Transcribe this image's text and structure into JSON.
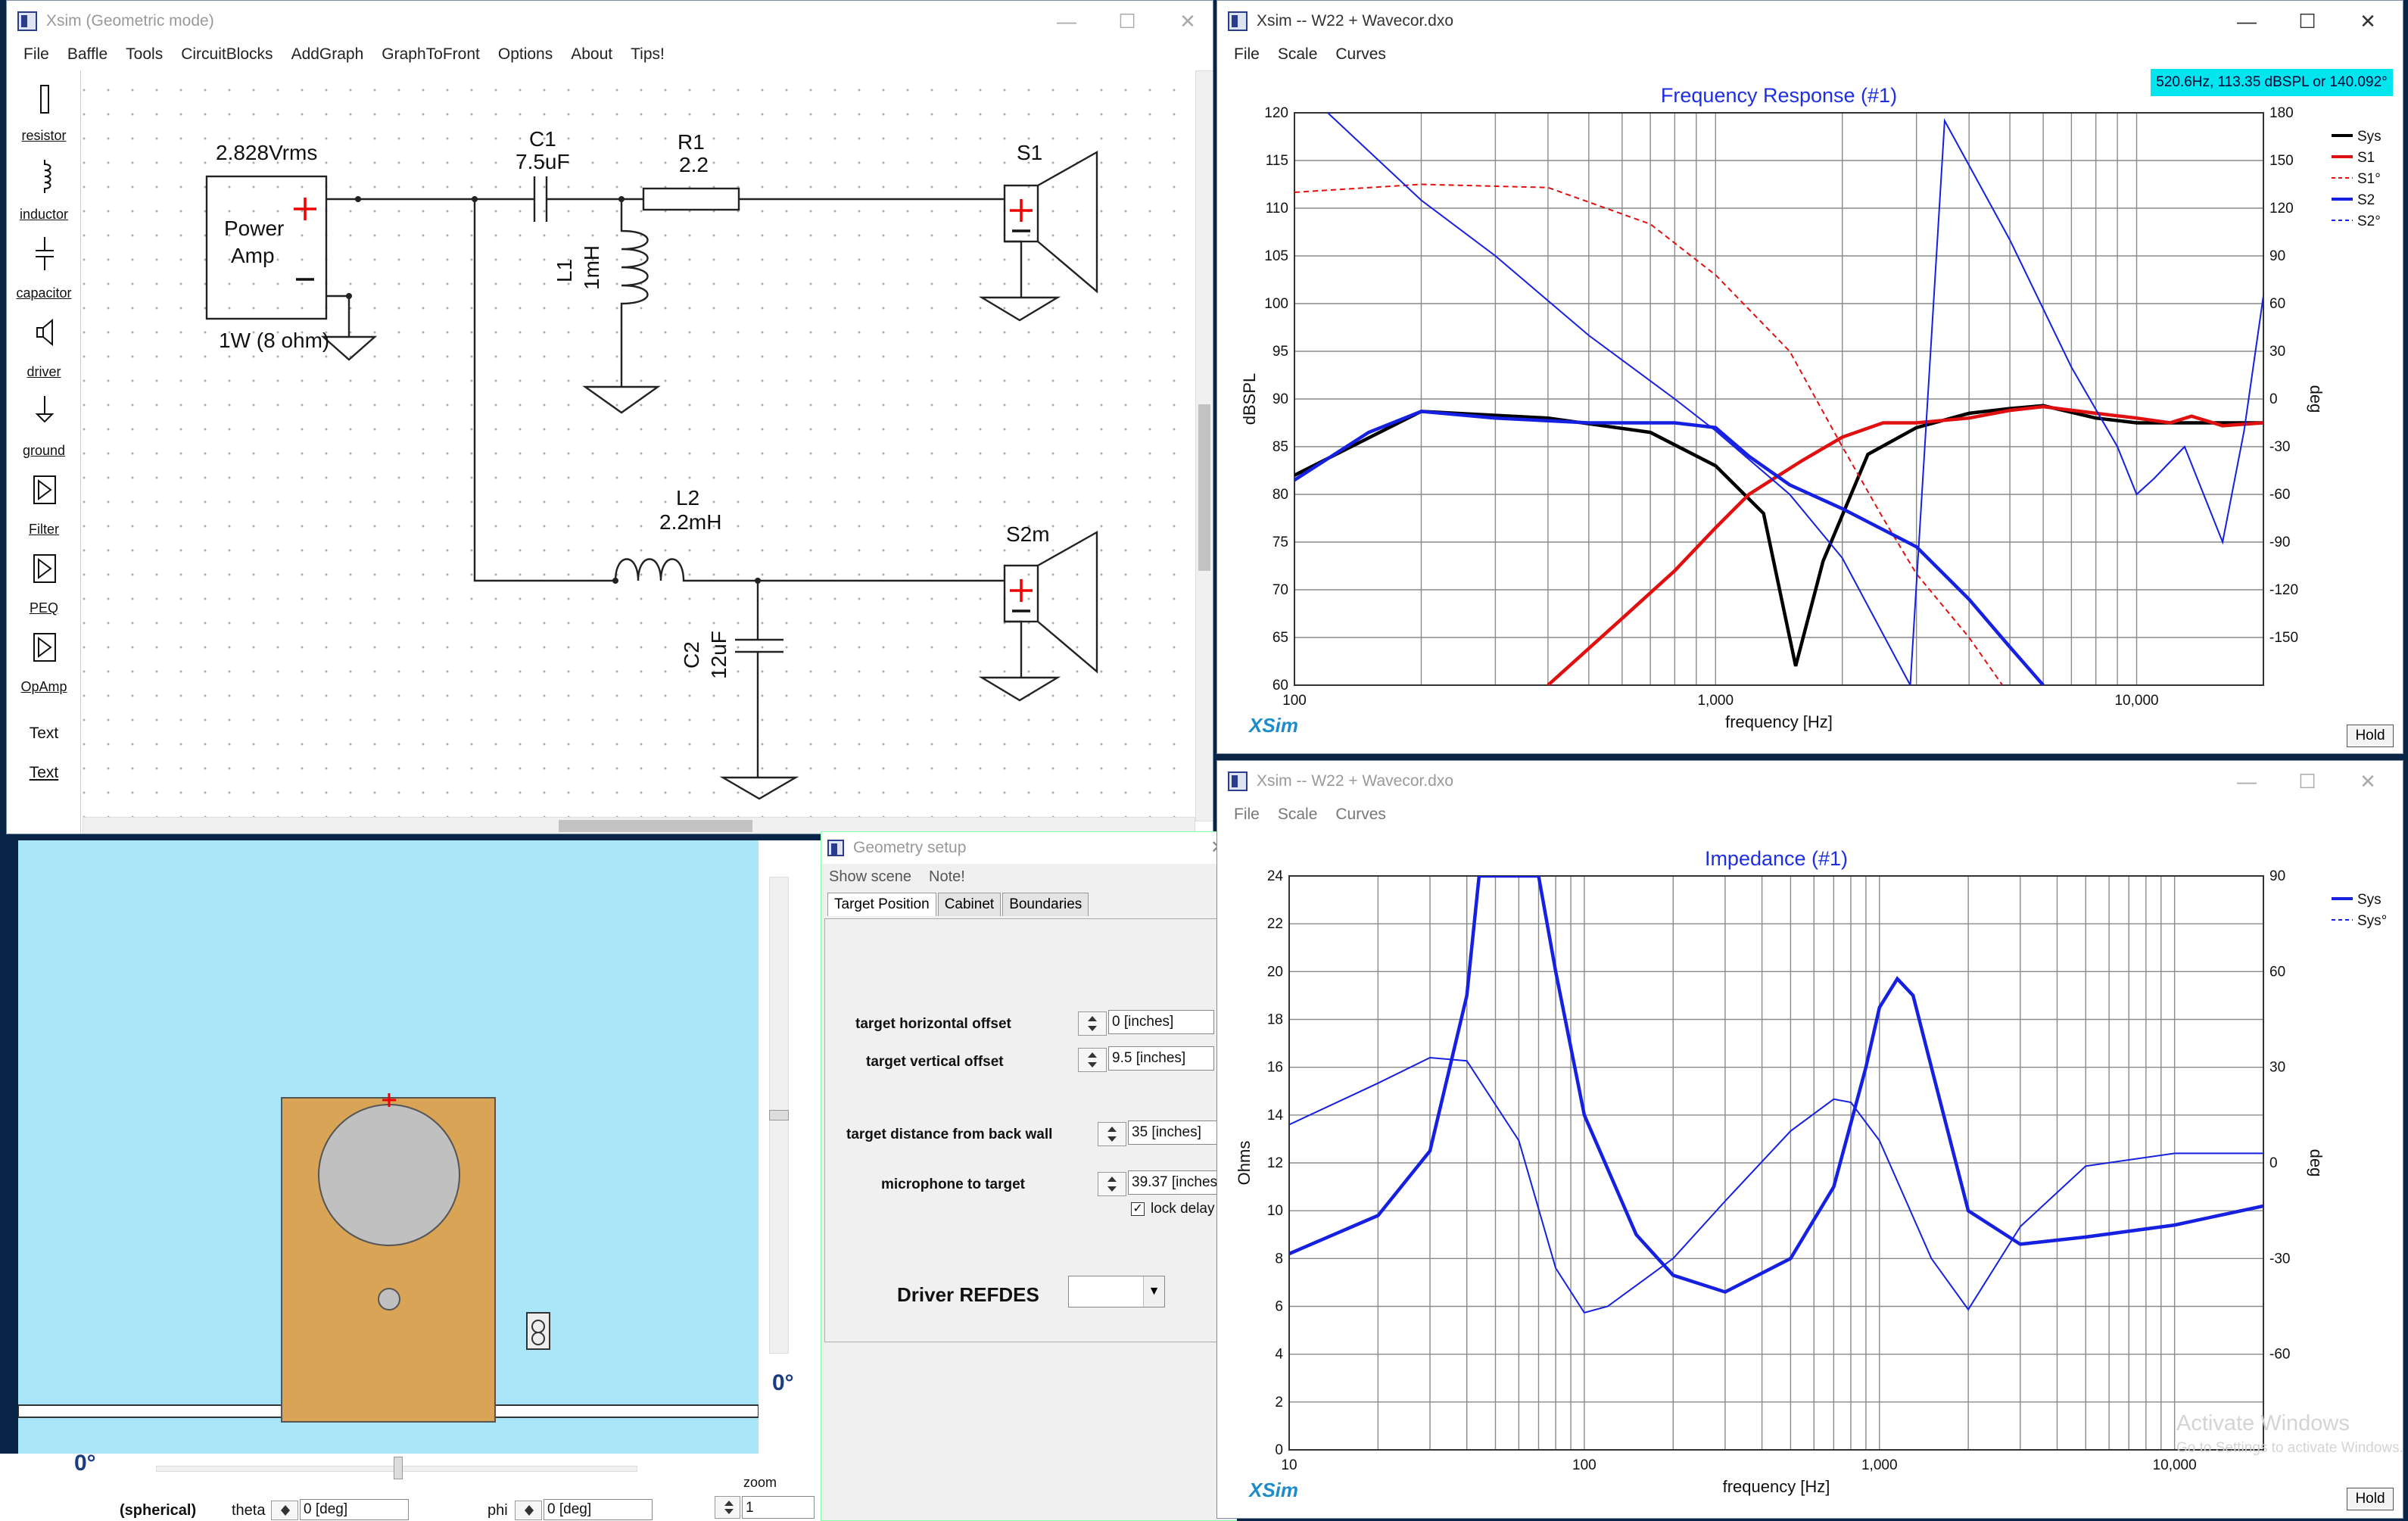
{
  "schematic_window": {
    "title": "Xsim (Geometric mode)",
    "menu": [
      "File",
      "Baffle",
      "Tools",
      "CircuitBlocks",
      "AddGraph",
      "GraphToFront",
      "Options",
      "About",
      "Tips!"
    ],
    "palette": [
      "resistor",
      "inductor",
      "capacitor",
      "driver",
      "ground",
      "Filter",
      "PEQ",
      "OpAmp",
      "Text",
      "Text"
    ],
    "amp": {
      "voltage": "2.828Vrms",
      "label1": "Power",
      "label2": "Amp",
      "power": "1W (8 ohm)"
    },
    "components": {
      "c1_name": "C1",
      "c1_value": "7.5uF",
      "r1_name": "R1",
      "r1_value": "2.2",
      "l1_name": "L1",
      "l1_value": "1mH",
      "s1_name": "S1",
      "l2_name": "L2",
      "l2_value": "2.2mH",
      "c2_name": "C2",
      "c2_value": "12uF",
      "s2_name": "S2m"
    }
  },
  "freq_window": {
    "title": "Xsim -- W22 + Wavecor.dxo",
    "menu": [
      "File",
      "Scale",
      "Curves"
    ],
    "readout": "520.6Hz, 113.35 dBSPL or 140.092°",
    "plot_title": "Frequency Response (#1)",
    "xlabel": "frequency [Hz]",
    "ylabel": "dBSPL",
    "y2label": "deg",
    "y_ticks": [
      "120",
      "115",
      "110",
      "105",
      "100",
      "95",
      "90",
      "85",
      "80",
      "75",
      "70",
      "65",
      "60"
    ],
    "y2_ticks": [
      "180",
      "150",
      "120",
      "90",
      "60",
      "30",
      "0",
      "-30",
      "-60",
      "-90",
      "-120",
      "-150"
    ],
    "x_ticks": [
      "100",
      "1,000",
      "10,000"
    ],
    "legend": [
      "Sys",
      "S1",
      "S1°",
      "S2",
      "S2°"
    ],
    "logo": "XSim",
    "hold": "Hold"
  },
  "imp_window": {
    "title": "Xsim -- W22 + Wavecor.dxo",
    "menu": [
      "File",
      "Scale",
      "Curves"
    ],
    "plot_title": "Impedance (#1)",
    "xlabel": "frequency [Hz]",
    "ylabel": "Ohms",
    "y2label": "deg",
    "y_ticks": [
      "24",
      "22",
      "20",
      "18",
      "16",
      "14",
      "12",
      "10",
      "8",
      "6",
      "4",
      "2",
      "0"
    ],
    "y2_ticks": [
      "90",
      "60",
      "30",
      "0",
      "-30",
      "-60"
    ],
    "x_ticks": [
      "10",
      "100",
      "1,000",
      "10,000"
    ],
    "legend": [
      "Sys",
      "Sys°"
    ],
    "logo": "XSim",
    "hold": "Hold"
  },
  "geometry": {
    "title": "Geometry setup",
    "menu": [
      "Show scene",
      "Note!"
    ],
    "tabs": [
      "Target Position",
      "Cabinet",
      "Boundaries"
    ],
    "fields": {
      "h_offset_label": "target horizontal offset",
      "h_offset": "0 [inches]",
      "v_offset_label": "target vertical offset",
      "v_offset": "9.5 [inches]",
      "back_wall_label": "target distance from back wall",
      "back_wall": "35 [inches]",
      "mic_label": "microphone to target",
      "mic": "39.37 [inches]",
      "lock_delay": "lock delay"
    },
    "driver_refdes_label": "Driver REFDES"
  },
  "scene": {
    "angle_right": "0°",
    "angle_bottom": "0°",
    "zoom_label": "zoom",
    "zoom_value": "1",
    "mode": "(spherical)",
    "theta_label": "theta",
    "theta_value": "0 [deg]",
    "phi_label": "phi",
    "phi_value": "0 [deg]"
  },
  "watermark": {
    "line1": "Activate Windows",
    "line2": "Go to Settings to activate Windows."
  },
  "chart_data": [
    {
      "type": "line",
      "title": "Frequency Response (#1)",
      "xlabel": "frequency [Hz]",
      "ylabel": "dBSPL",
      "xscale": "log",
      "xlim": [
        100,
        20000
      ],
      "ylim": [
        60,
        120
      ],
      "y2lim": [
        -180,
        180
      ],
      "legend_position": "top-right",
      "series": [
        {
          "name": "Sys",
          "color": "#000000",
          "axis": "y",
          "x": [
            100,
            200,
            400,
            700,
            1000,
            1300,
            1550,
            1800,
            2300,
            3000,
            4000,
            5000,
            6000,
            8000,
            10000,
            13000,
            16000,
            20000
          ],
          "y": [
            82,
            88.7,
            88,
            86.5,
            83,
            78,
            62,
            73,
            84.2,
            87,
            88.5,
            89,
            89.3,
            88,
            87.5,
            87.5,
            87.5,
            87.5
          ]
        },
        {
          "name": "S1",
          "color": "#e01010",
          "axis": "y",
          "x": [
            400,
            600,
            800,
            1000,
            1200,
            1600,
            2000,
            2500,
            3000,
            4000,
            5000,
            6000,
            8000,
            10000,
            12000,
            13500,
            16000,
            20000
          ],
          "y": [
            60,
            67,
            72,
            76.5,
            80,
            83.5,
            86,
            87.5,
            87.5,
            88,
            88.8,
            89.2,
            88.5,
            88,
            87.5,
            88.2,
            87.2,
            87.5
          ]
        },
        {
          "name": "S1°",
          "color": "#e01010",
          "axis": "y2",
          "x": [
            100,
            200,
            400,
            700,
            1000,
            1500,
            2000,
            2500,
            3000,
            4000,
            4800
          ],
          "y": [
            130,
            135,
            133,
            110,
            78,
            30,
            -30,
            -75,
            -110,
            -150,
            -180
          ]
        },
        {
          "name": "S2",
          "color": "#1520e0",
          "axis": "y",
          "x": [
            100,
            150,
            200,
            300,
            500,
            800,
            1000,
            1200,
            1500,
            2000,
            3000,
            4000,
            5000,
            6000
          ],
          "y": [
            81.5,
            86.5,
            88.7,
            88,
            87.5,
            87.5,
            87,
            84,
            81,
            78.5,
            74.5,
            69,
            64,
            60
          ]
        },
        {
          "name": "S2°",
          "color": "#1520e0",
          "axis": "y2",
          "x": [
            120,
            200,
            300,
            500,
            800,
            1000,
            1500,
            2000,
            2900,
            3500,
            5000,
            7000,
            9000,
            10000,
            11000,
            13000,
            16000,
            18000,
            20000
          ],
          "y": [
            180,
            125,
            90,
            40,
            0,
            -20,
            -60,
            -100,
            -180,
            175,
            100,
            20,
            -30,
            -60,
            -50,
            -30,
            -90,
            -20,
            65
          ]
        }
      ]
    },
    {
      "type": "line",
      "title": "Impedance (#1)",
      "xlabel": "frequency [Hz]",
      "ylabel": "Ohms",
      "xscale": "log",
      "xlim": [
        10,
        20000
      ],
      "ylim": [
        0,
        24
      ],
      "y2lim": [
        -90,
        90
      ],
      "legend_position": "top-right",
      "series": [
        {
          "name": "Sys",
          "color": "#1520e0",
          "axis": "y",
          "x": [
            10,
            20,
            30,
            40,
            44,
            50,
            60,
            70,
            80,
            100,
            150,
            200,
            300,
            500,
            700,
            900,
            1000,
            1150,
            1300,
            1500,
            2000,
            3000,
            5000,
            10000,
            20000
          ],
          "y": [
            8.2,
            9.8,
            12.5,
            19,
            24,
            24,
            24,
            24,
            20,
            14,
            9,
            7.3,
            6.6,
            8,
            11,
            16,
            18.5,
            19.7,
            19,
            16,
            10,
            8.6,
            8.9,
            9.4,
            10.2
          ]
        },
        {
          "name": "Sys°",
          "color": "#1520e0",
          "axis": "y2",
          "x": [
            10,
            20,
            30,
            40,
            60,
            80,
            100,
            120,
            200,
            300,
            500,
            700,
            800,
            1000,
            1500,
            2000,
            3000,
            5000,
            10000,
            20000
          ],
          "y": [
            12,
            25,
            33,
            32,
            7,
            -33,
            -47,
            -45,
            -30,
            -12,
            10,
            20,
            19,
            7,
            -30,
            -46,
            -20,
            -1,
            3,
            3
          ]
        }
      ]
    }
  ]
}
